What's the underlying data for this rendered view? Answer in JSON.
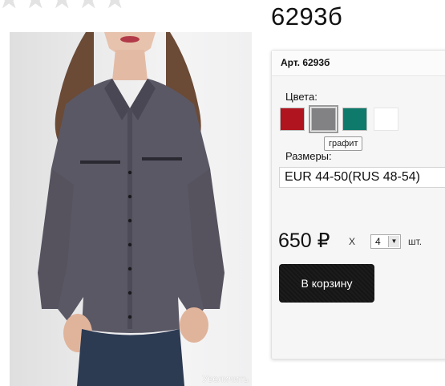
{
  "rating": {
    "stars": 5,
    "filled": 0
  },
  "product": {
    "title": "6293б",
    "zoom_label": "Увеличить"
  },
  "panel": {
    "sku_label": "Арт. 6293б",
    "colors_label": "Цвета:",
    "colors": [
      {
        "name": "red",
        "hex": "#b0141e"
      },
      {
        "name": "графит",
        "hex": "#828284",
        "selected": true
      },
      {
        "name": "teal",
        "hex": "#0e7a6c"
      },
      {
        "name": "white",
        "hex": "#ffffff"
      }
    ],
    "tooltip": "графит",
    "sizes_label": "Размеры:",
    "size_value": "EUR 44-50(RUS 48-54)",
    "price": "650 ₽",
    "times": "X",
    "quantity": "4",
    "unit": "шт.",
    "cart_button": "В корзину"
  }
}
